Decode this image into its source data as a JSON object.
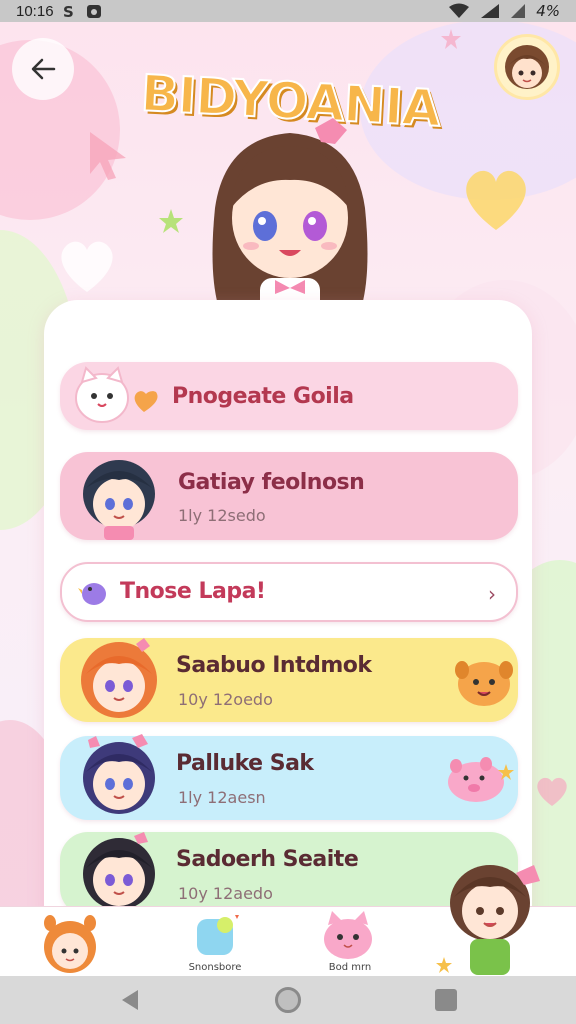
{
  "status_bar": {
    "time": "10:16",
    "battery": "4%"
  },
  "header": {
    "logo_text": "BIDYOANIA"
  },
  "list": {
    "items": [
      {
        "title": "Pnogeate Goila",
        "subtitle": ""
      },
      {
        "title": "Gatiay feolnosn",
        "subtitle": "1ly 12sedo"
      },
      {
        "title": "Tnose Lapa!",
        "subtitle": ""
      },
      {
        "title": "Saabuo Intdmok",
        "subtitle": "10y 12oedo"
      },
      {
        "title": "Palluke Sak",
        "subtitle": "1ly 12aesn"
      },
      {
        "title": "Sadoerh Seaite",
        "subtitle": "10y 12aedo"
      }
    ]
  },
  "tabbar": {
    "tabs": [
      {
        "label": ""
      },
      {
        "label": "Snonsbore"
      },
      {
        "label": "Bod mrn"
      },
      {
        "label": ""
      }
    ]
  },
  "colors": {
    "accent_pink": "#f48ab1",
    "item_yellow": "#fbe98c",
    "item_blue": "#c8eefb",
    "item_green": "#d6f3cf"
  }
}
